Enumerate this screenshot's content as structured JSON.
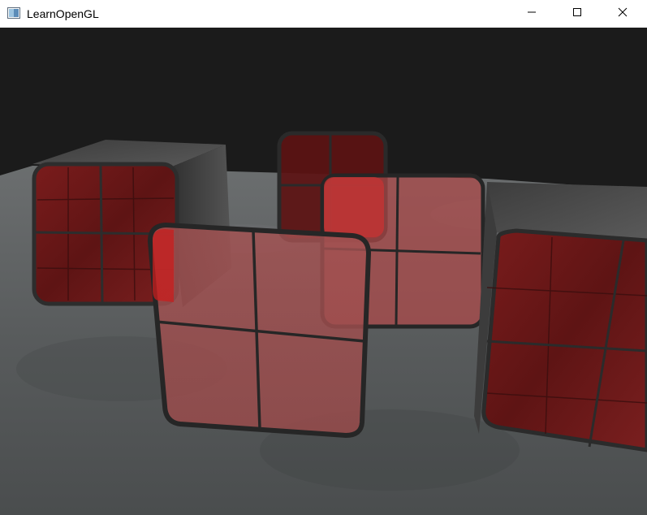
{
  "window": {
    "title": "LearnOpenGL",
    "icons": {
      "app": "window-app-icon",
      "minimize": "minimize-icon",
      "maximize": "maximize-icon",
      "close": "close-icon"
    }
  },
  "scene": {
    "background_color": "#1b1b1b",
    "floor_color": "#5a5d5e",
    "cube_color": "#4b4b4b",
    "panel_color": "#b43c3c",
    "panel_border_color": "#2a2a2a",
    "objects": [
      "floor",
      "cube-left",
      "cube-right",
      "window-back",
      "window-middle",
      "window-front"
    ]
  }
}
